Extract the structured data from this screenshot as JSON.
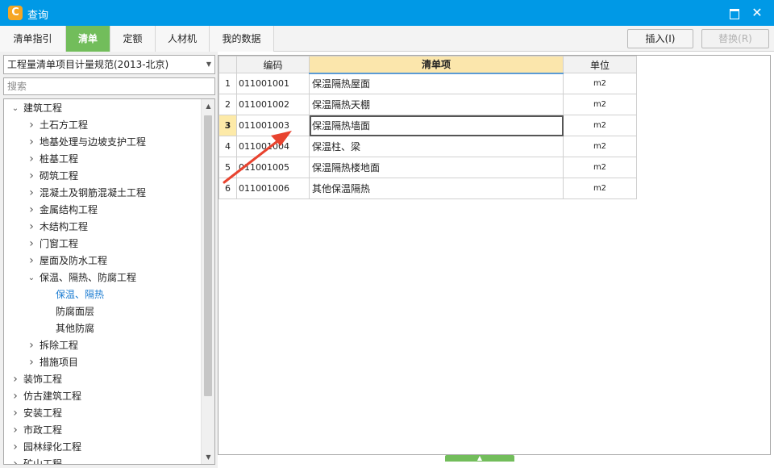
{
  "window": {
    "title": "查询",
    "app_icon": "C"
  },
  "tabs": [
    {
      "label": "清单指引",
      "active": false
    },
    {
      "label": "清单",
      "active": true
    },
    {
      "label": "定额",
      "active": false
    },
    {
      "label": "人材机",
      "active": false
    },
    {
      "label": "我的数据",
      "active": false
    }
  ],
  "toolbar": {
    "insert_label": "插入(I)",
    "replace_label": "替换(R)"
  },
  "left": {
    "standard": "工程量清单项目计量规范(2013-北京)",
    "search_placeholder": "搜索",
    "tree": [
      {
        "label": "建筑工程",
        "level": 0,
        "chevron": "down"
      },
      {
        "label": "土石方工程",
        "level": 1,
        "chevron": "right"
      },
      {
        "label": "地基处理与边坡支护工程",
        "level": 1,
        "chevron": "right"
      },
      {
        "label": "桩基工程",
        "level": 1,
        "chevron": "right"
      },
      {
        "label": "砌筑工程",
        "level": 1,
        "chevron": "right"
      },
      {
        "label": "混凝土及钢筋混凝土工程",
        "level": 1,
        "chevron": "right"
      },
      {
        "label": "金属结构工程",
        "level": 1,
        "chevron": "right"
      },
      {
        "label": "木结构工程",
        "level": 1,
        "chevron": "right"
      },
      {
        "label": "门窗工程",
        "level": 1,
        "chevron": "right"
      },
      {
        "label": "屋面及防水工程",
        "level": 1,
        "chevron": "right"
      },
      {
        "label": "保温、隔热、防腐工程",
        "level": 1,
        "chevron": "down"
      },
      {
        "label": "保温、隔热",
        "level": 2,
        "chevron": "",
        "selected": true
      },
      {
        "label": "防腐面层",
        "level": 2,
        "chevron": ""
      },
      {
        "label": "其他防腐",
        "level": 2,
        "chevron": ""
      },
      {
        "label": "拆除工程",
        "level": 1,
        "chevron": "right"
      },
      {
        "label": "措施项目",
        "level": 1,
        "chevron": "right"
      },
      {
        "label": "装饰工程",
        "level": 0,
        "chevron": "right"
      },
      {
        "label": "仿古建筑工程",
        "level": 0,
        "chevron": "right"
      },
      {
        "label": "安装工程",
        "level": 0,
        "chevron": "right"
      },
      {
        "label": "市政工程",
        "level": 0,
        "chevron": "right"
      },
      {
        "label": "园林绿化工程",
        "level": 0,
        "chevron": "right"
      },
      {
        "label": "矿山工程",
        "level": 0,
        "chevron": "right"
      }
    ]
  },
  "grid": {
    "columns": {
      "code": "编码",
      "name": "清单项",
      "unit": "单位"
    },
    "rows": [
      {
        "no": "1",
        "code": "011001001",
        "name": "保温隔热屋面",
        "unit": "m2"
      },
      {
        "no": "2",
        "code": "011001002",
        "name": "保温隔热天棚",
        "unit": "m2"
      },
      {
        "no": "3",
        "code": "011001003",
        "name": "保温隔热墙面",
        "unit": "m2",
        "current": true
      },
      {
        "no": "4",
        "code": "011001004",
        "name": "保温柱、梁",
        "unit": "m2"
      },
      {
        "no": "5",
        "code": "011001005",
        "name": "保温隔热楼地面",
        "unit": "m2"
      },
      {
        "no": "6",
        "code": "011001006",
        "name": "其他保温隔热",
        "unit": "m2"
      }
    ]
  },
  "colors": {
    "titlebar": "#0099e6",
    "active_tab": "#72bd5b",
    "annotation_arrow": "#e8432f"
  }
}
